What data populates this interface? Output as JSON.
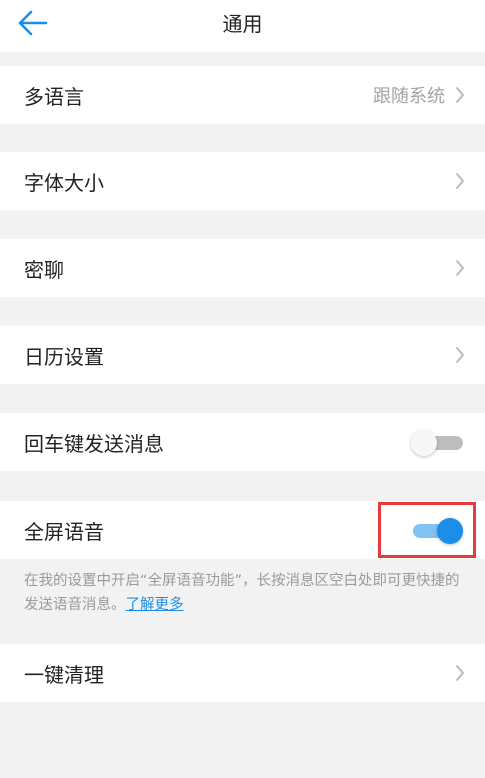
{
  "header": {
    "title": "通用",
    "back_icon": "arrow-left-icon"
  },
  "colors": {
    "accent": "#1a8ee8",
    "highlight": "#e8393b",
    "background": "#f2f2f2"
  },
  "settings": {
    "language": {
      "label": "多语言",
      "value": "跟随系统"
    },
    "font_size": {
      "label": "字体大小"
    },
    "secret_chat": {
      "label": "密聊"
    },
    "calendar": {
      "label": "日历设置"
    },
    "enter_send": {
      "label": "回车键发送消息",
      "enabled": false
    },
    "fullscreen_voice": {
      "label": "全屏语音",
      "enabled": true
    },
    "fullscreen_voice_hint": {
      "text": "在我的设置中开启“全屏语音功能”，长按消息区空白处即可更快捷的发送语音消息。",
      "link": "了解更多"
    },
    "one_click_clean": {
      "label": "一键清理"
    }
  }
}
